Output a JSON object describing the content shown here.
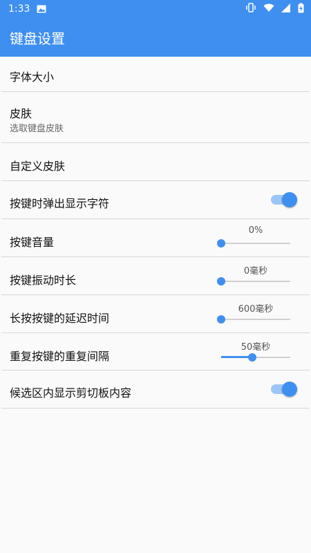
{
  "status_bar": {
    "time": "1:33",
    "icons": [
      "image-icon",
      "vibrate-icon",
      "wifi-icon",
      "signal-icon",
      "battery-charging-icon"
    ]
  },
  "app_bar": {
    "title": "键盘设置"
  },
  "colors": {
    "primary": "#3f8ff0",
    "switch_track_on": "#9cc6f7",
    "slider_track": "#cfcfcf"
  },
  "settings": [
    {
      "title": "字体大小"
    },
    {
      "title": "皮肤",
      "summary": "选取键盘皮肤"
    },
    {
      "title": "自定义皮肤"
    },
    {
      "title": "按键时弹出显示字符",
      "switch_on": true
    },
    {
      "title": "按键音量",
      "value_label": "0%",
      "slider_fraction": 0.0
    },
    {
      "title": "按键振动时长",
      "value_label": "0毫秒",
      "slider_fraction": 0.0
    },
    {
      "title": "长按按键的延迟时间",
      "value_label": "600毫秒",
      "slider_fraction": 0.0
    },
    {
      "title": "重复按键的重复间隔",
      "value_label": "50毫秒",
      "slider_fraction": 0.45
    },
    {
      "title": "候选区内显示剪切板内容",
      "switch_on": true
    }
  ]
}
